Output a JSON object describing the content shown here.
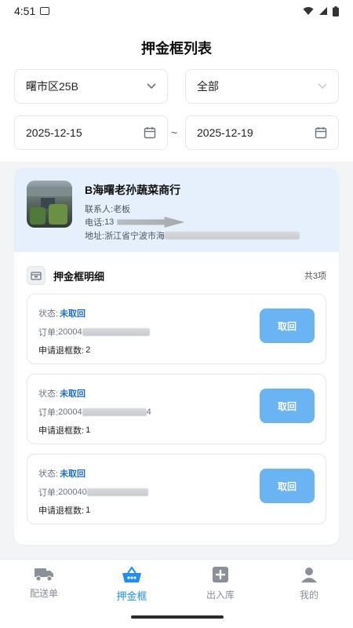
{
  "status_bar": {
    "time": "4:51"
  },
  "page": {
    "title": "押金框列表"
  },
  "filters": {
    "district": "曙市区25B",
    "category": "全部",
    "date_start": "2025-12-15",
    "date_sep": "~",
    "date_end": "2025-12-19"
  },
  "shop": {
    "name": "B海曙老孙蔬菜商行",
    "contact_label": "联系人:",
    "contact_value": "老板",
    "phone_label": "电话:",
    "phone_value": "13",
    "address_label": "地址:",
    "address_value": "浙江省宁波市海"
  },
  "detail": {
    "title": "押金框明细",
    "count": "共3项",
    "items": [
      {
        "status_label": "状态:",
        "status": "未取回",
        "order_label": "订单:",
        "order": "20004",
        "qty_label": "申请退框数:",
        "qty": "2",
        "button": "取回"
      },
      {
        "status_label": "状态:",
        "status": "未取回",
        "order_label": "订单:",
        "order": "20004",
        "order_tail": "4",
        "qty_label": "申请退框数:",
        "qty": "1",
        "button": "取回"
      },
      {
        "status_label": "状态:",
        "status": "未取回",
        "order_label": "订单:",
        "order": "200040",
        "qty_label": "申请退框数:",
        "qty": "1",
        "button": "取回"
      }
    ]
  },
  "tabs": [
    {
      "label": "配送单",
      "icon": "truck-icon"
    },
    {
      "label": "押金框",
      "icon": "basket-icon",
      "active": true
    },
    {
      "label": "出入库",
      "icon": "plus-square-icon"
    },
    {
      "label": "我的",
      "icon": "user-icon"
    }
  ],
  "colors": {
    "accent": "#1f8ef0",
    "button": "#6ab4f3",
    "status": "#1f6fd1",
    "shop_bg": "#e6f0fc"
  }
}
